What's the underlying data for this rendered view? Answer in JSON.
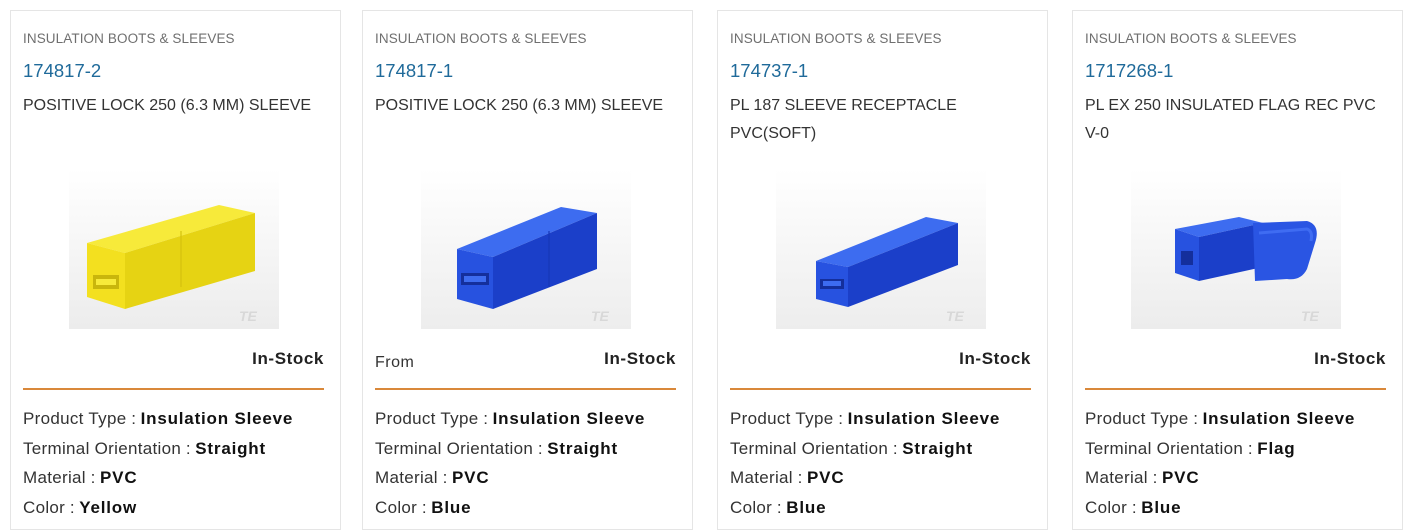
{
  "cards": [
    {
      "category": "INSULATION BOOTS & SLEEVES",
      "part_number": "174817-2",
      "description": "POSITIVE LOCK 250 (6.3 MM) SLEEVE",
      "from_label": "",
      "stock": "In-Stock",
      "color_hex": "#f2e21c",
      "image_icon": "yellow-straight-sleeve",
      "watermark": "TE",
      "attributes": [
        {
          "label": "Product Type",
          "sep": " : ",
          "value": "Insulation Sleeve"
        },
        {
          "label": "Terminal Orientation",
          "sep": " : ",
          "value": "Straight"
        },
        {
          "label": "Material",
          "sep": " : ",
          "value": "PVC"
        },
        {
          "label": "Color",
          "sep": " : ",
          "value": "Yellow"
        }
      ]
    },
    {
      "category": "INSULATION BOOTS & SLEEVES",
      "part_number": "174817-1",
      "description": "POSITIVE LOCK 250 (6.3 MM) SLEEVE",
      "from_label": "From",
      "stock": "In-Stock",
      "color_hex": "#1f48d8",
      "image_icon": "blue-straight-sleeve",
      "watermark": "TE",
      "attributes": [
        {
          "label": "Product Type",
          "sep": " : ",
          "value": "Insulation Sleeve"
        },
        {
          "label": "Terminal Orientation",
          "sep": " : ",
          "value": "Straight"
        },
        {
          "label": "Material",
          "sep": " : ",
          "value": "PVC"
        },
        {
          "label": "Color",
          "sep": " : ",
          "value": "Blue"
        }
      ]
    },
    {
      "category": "INSULATION BOOTS & SLEEVES",
      "part_number": "174737-1",
      "description": "PL 187 SLEEVE RECEPTACLE PVC(SOFT)",
      "from_label": "",
      "stock": "In-Stock",
      "color_hex": "#1f48d8",
      "image_icon": "blue-straight-sleeve",
      "watermark": "TE",
      "attributes": [
        {
          "label": "Product Type",
          "sep": " : ",
          "value": "Insulation Sleeve"
        },
        {
          "label": "Terminal Orientation",
          "sep": " : ",
          "value": "Straight"
        },
        {
          "label": "Material",
          "sep": " : ",
          "value": "PVC"
        },
        {
          "label": "Color",
          "sep": " : ",
          "value": "Blue"
        }
      ]
    },
    {
      "category": "INSULATION BOOTS & SLEEVES",
      "part_number": "1717268-1",
      "description": "PL EX 250 INSULATED FLAG REC PVC V-0",
      "from_label": "",
      "stock": "In-Stock",
      "color_hex": "#1f48d8",
      "image_icon": "blue-flag-sleeve",
      "watermark": "TE",
      "attributes": [
        {
          "label": "Product Type",
          "sep": " : ",
          "value": "Insulation Sleeve"
        },
        {
          "label": "Terminal Orientation",
          "sep": " : ",
          "value": "Flag"
        },
        {
          "label": "Material",
          "sep": " : ",
          "value": "PVC"
        },
        {
          "label": "Color",
          "sep": " : ",
          "value": "Blue"
        }
      ]
    }
  ]
}
